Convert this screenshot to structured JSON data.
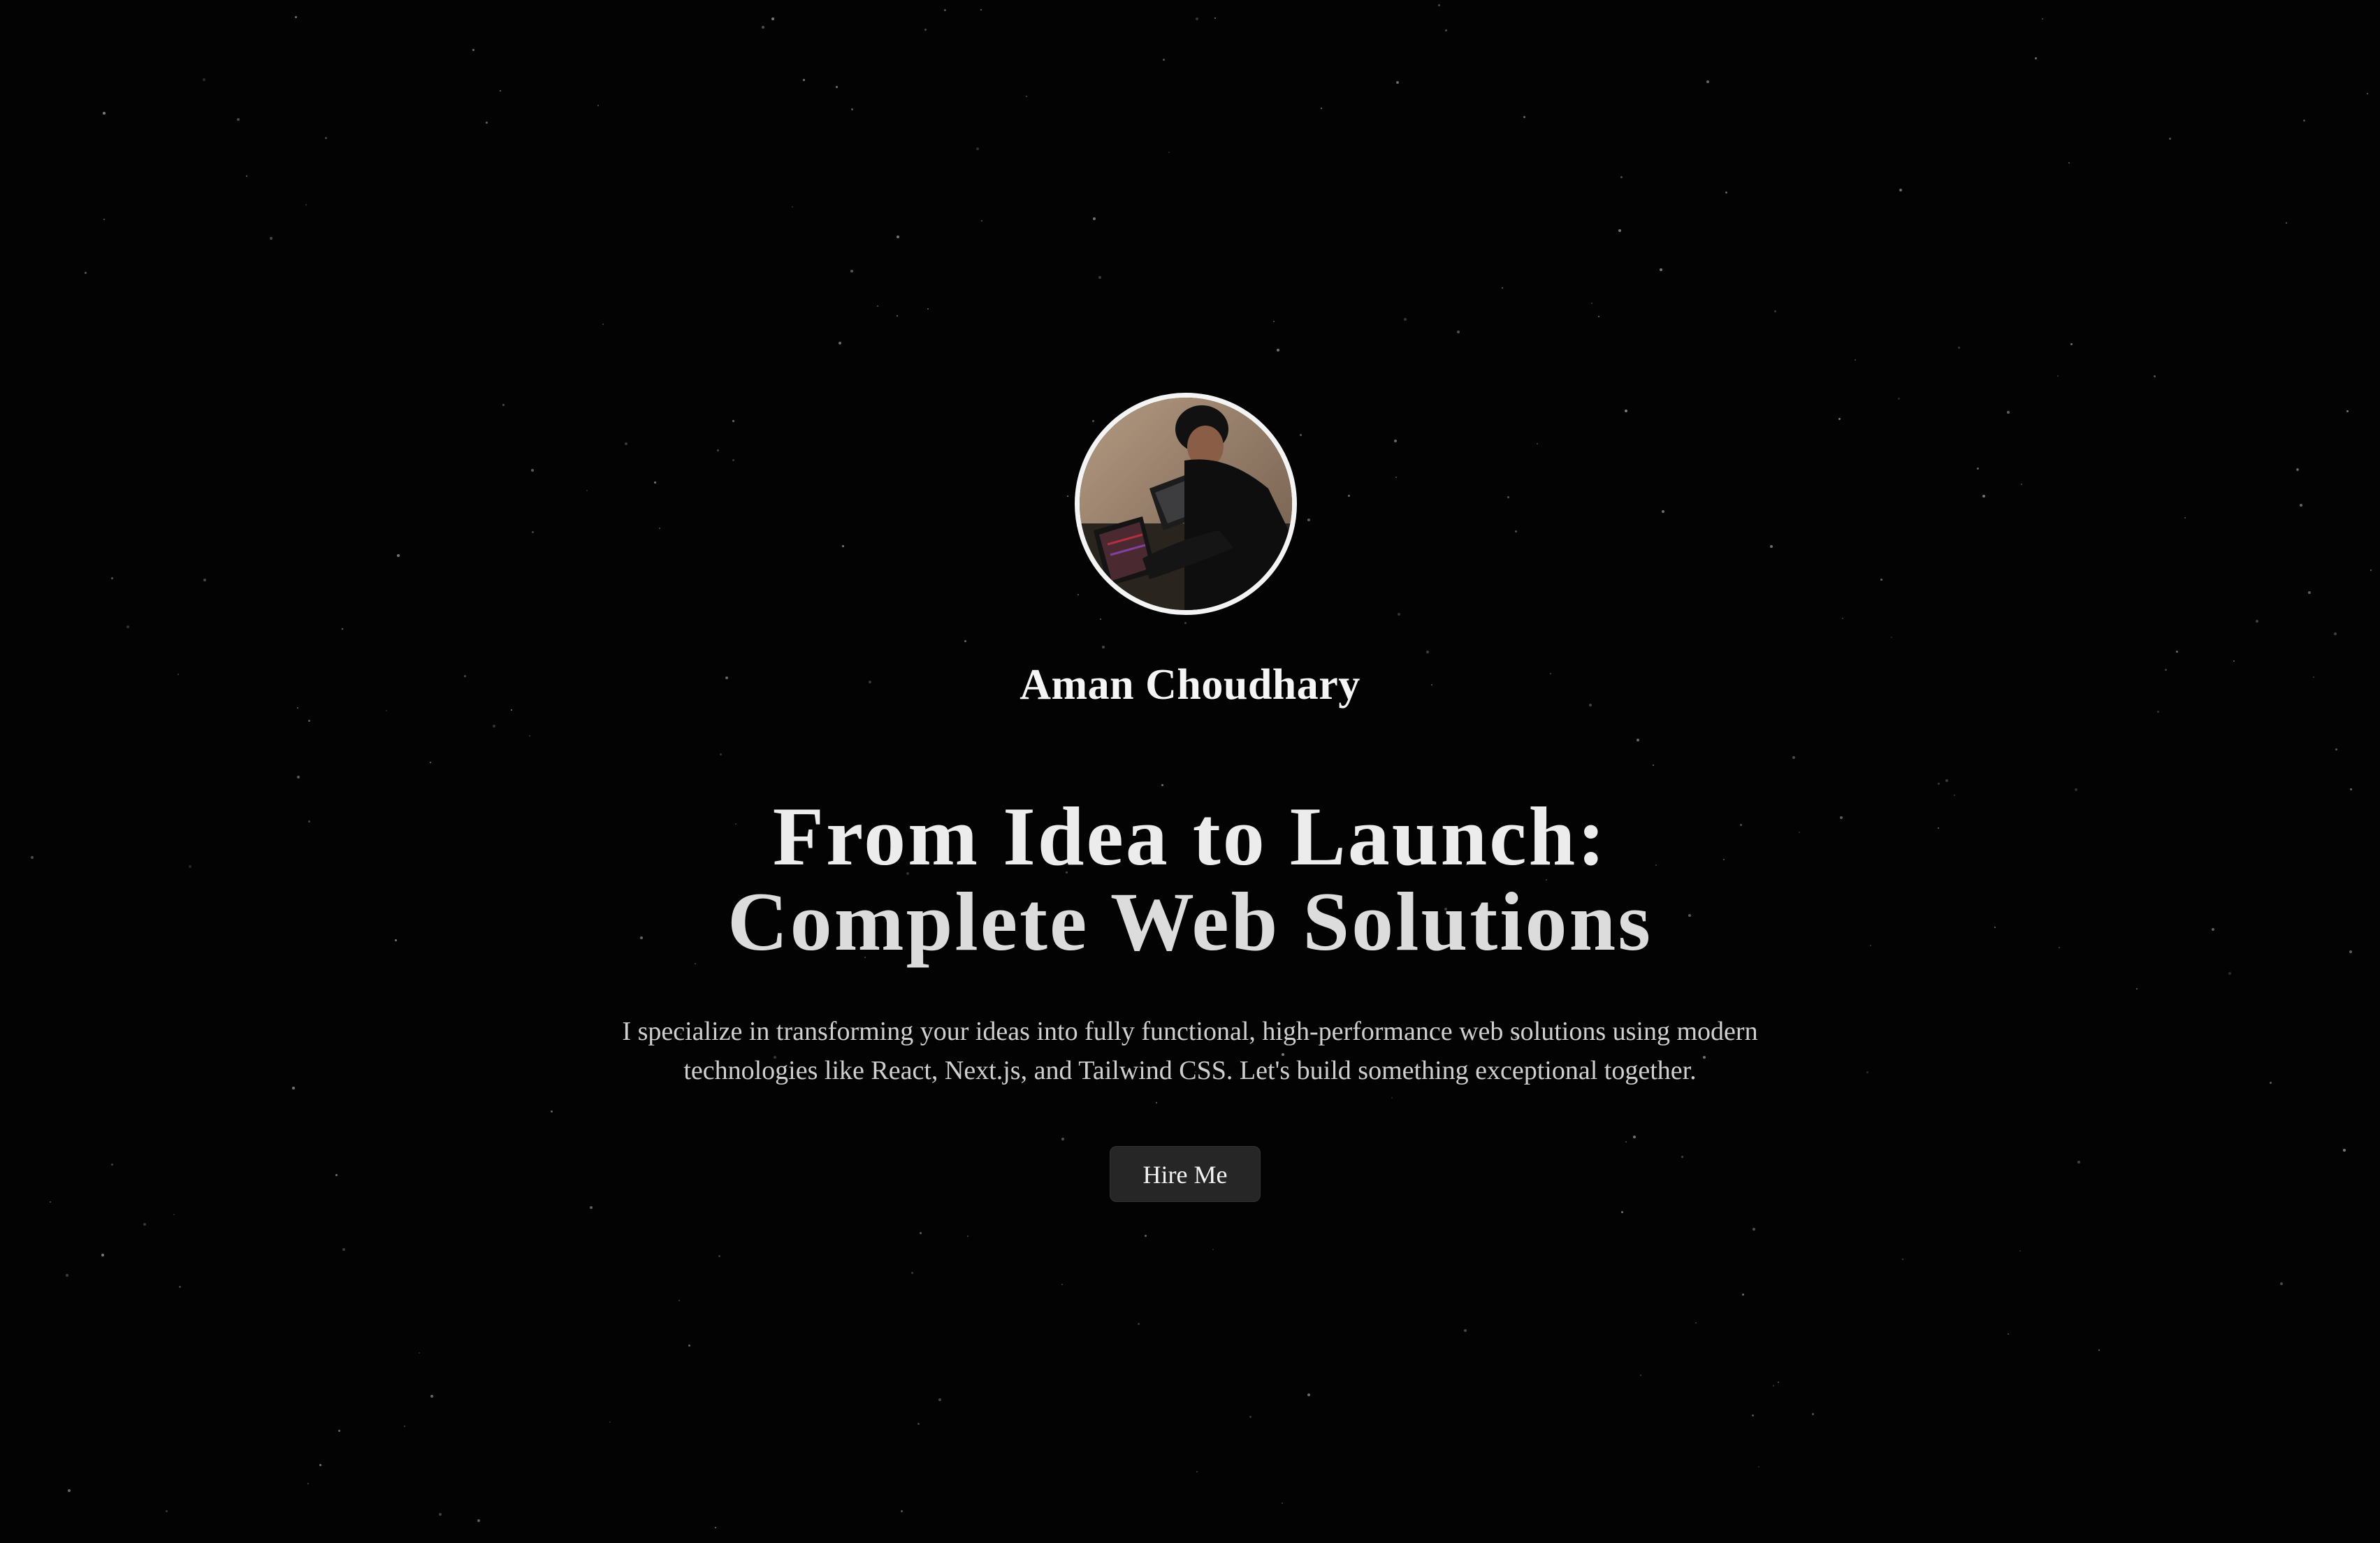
{
  "profile": {
    "name": "Aman Choudhary",
    "avatar_alt": "profile photo of person working at laptop"
  },
  "hero": {
    "headline_line1": "From Idea to Launch:",
    "headline_line2": "Complete Web Solutions",
    "description_line1": "I specialize in transforming your ideas into fully functional, high-performance web solutions using modern",
    "description_line2": "technologies like React, Next.js, and Tailwind CSS. Let's build something exceptional together.",
    "cta_label": "Hire Me"
  },
  "colors": {
    "background": "#030303",
    "text": "#f5f5f5",
    "button_bg": "#262626",
    "avatar_border": "#f4f4f4"
  }
}
